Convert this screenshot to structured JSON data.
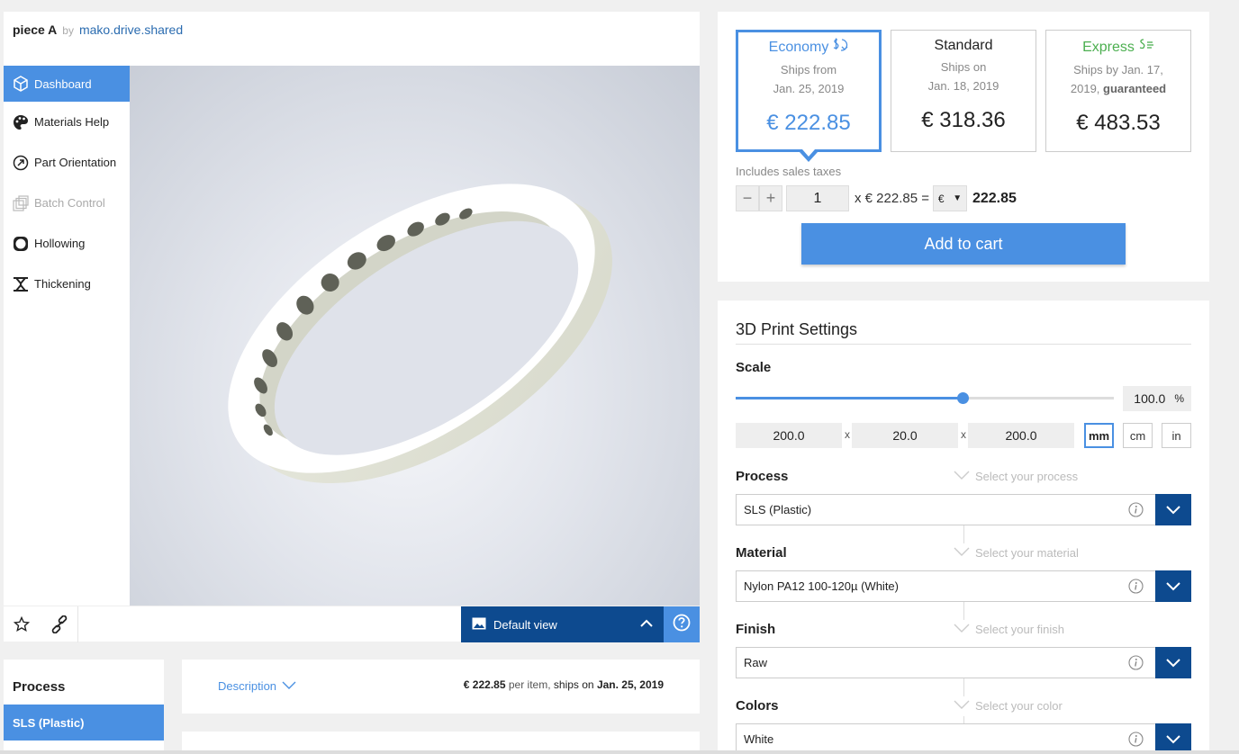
{
  "header": {
    "piece_name": "piece A",
    "by": "by",
    "owner": "mako.drive.shared"
  },
  "sidebar": {
    "items": [
      {
        "label": "Dashboard",
        "icon": "cube-icon",
        "state": "active"
      },
      {
        "label": "Materials Help",
        "icon": "palette-icon",
        "state": "normal"
      },
      {
        "label": "Part Orientation",
        "icon": "orientation-icon",
        "state": "normal"
      },
      {
        "label": "Batch Control",
        "icon": "layers-icon",
        "state": "disabled"
      },
      {
        "label": "Hollowing",
        "icon": "hollow-icon",
        "state": "normal"
      },
      {
        "label": "Thickening",
        "icon": "thicken-icon",
        "state": "normal"
      }
    ]
  },
  "viewer": {
    "default_view_label": "Default view"
  },
  "process_panel": {
    "heading": "Process",
    "selected": "SLS (Plastic)"
  },
  "description": {
    "link_label": "Description",
    "price": "€ 222.85",
    "per_item": "per item,",
    "ships_on": "ships on",
    "date": "Jan. 25, 2019"
  },
  "shipping": {
    "options": [
      {
        "name": "Economy",
        "line1": "Ships from",
        "line2": "Jan. 25, 2019",
        "bold": "",
        "price": "€ 222.85",
        "selected": true
      },
      {
        "name": "Standard",
        "line1": "Ships on",
        "line2": "Jan. 18, 2019",
        "bold": "",
        "price": "€ 318.36",
        "selected": false
      },
      {
        "name": "Express",
        "line1": "Ships by Jan. 17,",
        "line2": "2019,",
        "bold": "guaranteed",
        "price": "€ 483.53",
        "selected": false
      }
    ],
    "taxes_note": "Includes sales taxes",
    "minus": "−",
    "plus": "+",
    "quantity": "1",
    "times_text": "x € 222.85 =",
    "currency": "€",
    "total": "222.85",
    "add_to_cart": "Add to cart"
  },
  "settings": {
    "title": "3D Print Settings",
    "scale_label": "Scale",
    "scale_fraction": 0.6,
    "scale_value": "100.0",
    "scale_unit": "%",
    "dims": [
      "200.0",
      "20.0",
      "200.0"
    ],
    "x_sep": "x",
    "units": [
      "mm",
      "cm",
      "in"
    ],
    "selected_unit": "mm",
    "process_label": "Process",
    "process_hint": "Select your process",
    "process_value": "SLS (Plastic)",
    "material_label": "Material",
    "material_hint": "Select your material",
    "material_value": "Nylon PA12 100-120µ (White)",
    "finish_label": "Finish",
    "finish_hint": "Select your finish",
    "finish_value": "Raw",
    "colors_label": "Colors",
    "colors_hint": "Select your color",
    "colors_value": "White"
  },
  "colors": {
    "accent": "#4a90e2",
    "dark_blue": "#0d4a8f",
    "express_green": "#4caf50"
  }
}
